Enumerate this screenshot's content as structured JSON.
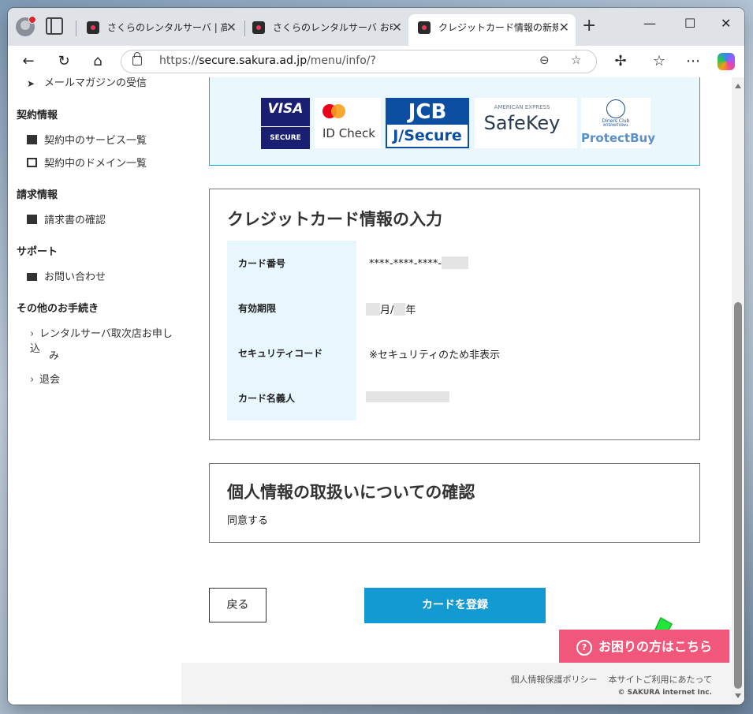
{
  "browser": {
    "tabs": [
      {
        "title": "さくらのレンタルサーバ | 高速・安定",
        "active": false
      },
      {
        "title": "さくらのレンタルサーバ お申し込み",
        "active": false
      },
      {
        "title": "クレジットカード情報の新規登録",
        "active": true
      }
    ],
    "url_prefix": "https://",
    "url_host": "secure.sakura.ad.jp",
    "url_path": "/menu/info/?",
    "icons": [
      "back-icon",
      "refresh-icon",
      "home-icon",
      "lock-icon",
      "zoom-icon",
      "star-icon",
      "extensions-icon",
      "favorites-icon",
      "more-icon",
      "copilot-icon"
    ]
  },
  "sidebar": {
    "top_item": "メールマガジンの受信",
    "sections": [
      {
        "heading": "契約情報",
        "items": [
          "契約中のサービス一覧",
          "契約中のドメイン一覧"
        ]
      },
      {
        "heading": "請求情報",
        "items": [
          "請求書の確認"
        ]
      },
      {
        "heading": "サポート",
        "items": [
          "お問い合わせ"
        ]
      },
      {
        "heading": "その他のお手続き",
        "items": [
          "レンタルサーバ取次店お申し込",
          "み",
          "退会"
        ]
      }
    ]
  },
  "brands": {
    "visa_line1": "VISA",
    "visa_line2": "SECURE",
    "mc": "ID Check",
    "jcb_line1": "JCB",
    "jcb_line2": "J/Secure",
    "amex_line1": "AMERICAN EXPRESS",
    "amex_line2": "SafeKey",
    "diners_line1": "Diners Club",
    "diners_line2": "INTERNATIONAL",
    "diners_line3": "ProtectBuy"
  },
  "card_form": {
    "title": "クレジットカード情報の入力",
    "rows": [
      {
        "label": "カード番号",
        "value": "****-****-****-"
      },
      {
        "label": "有効期限",
        "month_suffix": "月/",
        "year_suffix": "年"
      },
      {
        "label": "セキュリティコード",
        "value": "※セキュリティのため非表示"
      },
      {
        "label": "カード名義人",
        "value": ""
      }
    ]
  },
  "privacy": {
    "title": "個人情報の取扱いについての確認",
    "value": "同意する"
  },
  "actions": {
    "back_label": "戻る",
    "register_label": "カードを登録"
  },
  "help": {
    "label": "お困りの方はこちら",
    "icon": "?"
  },
  "footer": {
    "privacy_link": "個人情報保護ポリシー",
    "terms_link": "本サイトご利用にあたって",
    "copyright": "© SAKURA internet Inc."
  },
  "colors": {
    "accent": "#139ad2",
    "help": "#f0577a",
    "arrow": "#22e63a"
  }
}
